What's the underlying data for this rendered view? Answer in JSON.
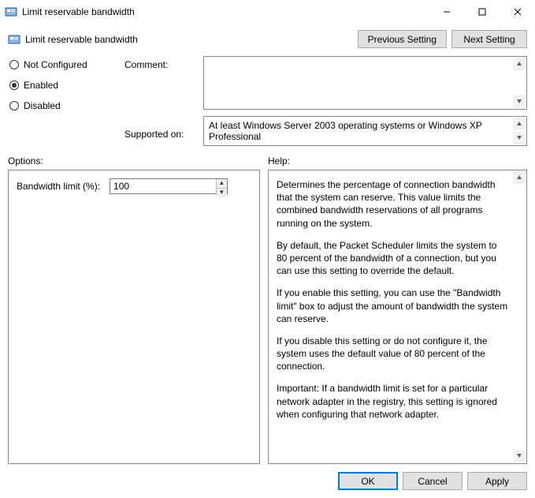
{
  "titlebar": {
    "title": "Limit reservable bandwidth"
  },
  "header": {
    "subtitle": "Limit reservable bandwidth",
    "prev": "Previous Setting",
    "next": "Next Setting"
  },
  "state": {
    "not_configured": "Not Configured",
    "enabled": "Enabled",
    "disabled": "Disabled",
    "selected": "enabled"
  },
  "labels": {
    "comment": "Comment:",
    "supported": "Supported on:",
    "options": "Options:",
    "help": "Help:"
  },
  "comment": {
    "text": ""
  },
  "supported": {
    "text": "At least Windows Server 2003 operating systems or Windows XP Professional"
  },
  "options": {
    "bandwidth_label": "Bandwidth limit (%):",
    "bandwidth_value": "100"
  },
  "help": {
    "p1": "Determines the percentage of connection bandwidth that the system can reserve. This value limits the combined bandwidth reservations of all programs running on the system.",
    "p2": "By default, the Packet Scheduler limits the system to 80 percent of the bandwidth of a connection, but you can use this setting to override the default.",
    "p3": "If you enable this setting, you can use the \"Bandwidth limit\" box to adjust the amount of bandwidth the system can reserve.",
    "p4": "If you disable this setting or do not configure it, the system uses the default value of 80 percent of the connection.",
    "p5": "Important: If a bandwidth limit is set for a particular network adapter in the registry, this setting is ignored when configuring that network adapter."
  },
  "footer": {
    "ok": "OK",
    "cancel": "Cancel",
    "apply": "Apply"
  }
}
